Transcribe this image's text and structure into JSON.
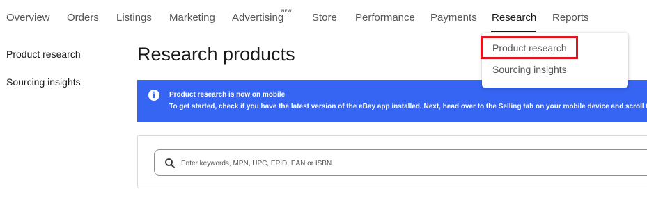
{
  "topnav": {
    "items": [
      {
        "label": "Overview"
      },
      {
        "label": "Orders"
      },
      {
        "label": "Listings"
      },
      {
        "label": "Marketing"
      },
      {
        "label": "Advertising",
        "badge": "NEW"
      },
      {
        "label": "Store"
      },
      {
        "label": "Performance"
      },
      {
        "label": "Payments"
      },
      {
        "label": "Research",
        "active": true
      },
      {
        "label": "Reports"
      }
    ]
  },
  "sidenav": {
    "items": [
      {
        "label": "Product research",
        "active": true
      },
      {
        "label": "Sourcing insights"
      }
    ]
  },
  "page": {
    "title": "Research products"
  },
  "banner": {
    "icon": "info-icon",
    "title": "Product research is now on mobile",
    "body": "To get started, check if you have the latest version of the eBay app installed. Next, head over to the Selling tab on your mobile device and scroll to",
    "color": "#3665f3"
  },
  "search": {
    "placeholder": "Enter keywords, MPN, UPC, EPID, EAN or ISBN",
    "value": "",
    "icon": "search-icon"
  },
  "dropdown": {
    "items": [
      {
        "label": "Product research",
        "highlighted": true
      },
      {
        "label": "Sourcing insights"
      }
    ],
    "highlight_color": "#e0161f"
  }
}
